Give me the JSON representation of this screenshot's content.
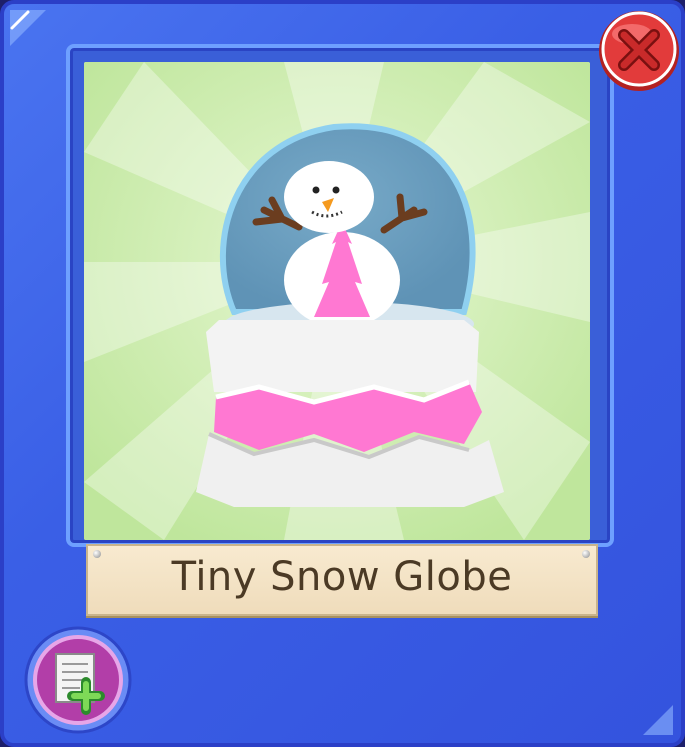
{
  "item": {
    "name": "Tiny Snow Globe"
  },
  "colors": {
    "frame_blue": "#3a5fe6",
    "frame_highlight": "#6ea0ff",
    "picture_background": "#c8eba8",
    "nameplate": "#f4e4c6",
    "nameplate_text": "#4b3a25",
    "close_button": "#e23b3b",
    "add_button": "#b23ea8",
    "snowman_sweater": "#ff78d2",
    "globe_glass": "#6a9fc0"
  },
  "icons": {
    "close": "close-x-icon",
    "add_to_list": "document-plus-icon"
  }
}
